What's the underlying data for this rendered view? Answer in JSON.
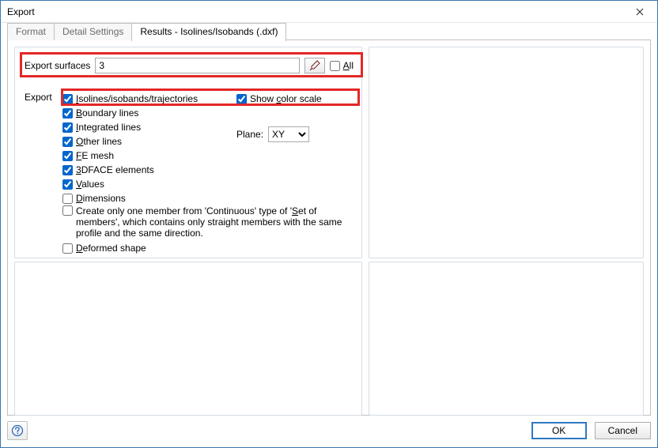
{
  "window": {
    "title": "Export"
  },
  "tabs": {
    "format": "Format",
    "detail": "Detail Settings",
    "results": "Results - Isolines/Isobands (.dxf)"
  },
  "surfaces": {
    "label": "Export surfaces",
    "value": "3",
    "all_label_u": "A",
    "all_label_rest": "ll"
  },
  "export": {
    "label": "Export",
    "items": {
      "isolines_u": "I",
      "isolines_rest": "solines/isobands/trajectories",
      "boundary_u": "B",
      "boundary_rest": "oundary lines",
      "integrated_u": "I",
      "integrated_rest": "ntegrated lines",
      "other_u": "O",
      "other_rest": "ther lines",
      "femesh_u": "F",
      "femesh_rest": "E mesh",
      "threedface_u": "3",
      "threedface_rest": "DFACE elements",
      "values_u": "V",
      "values_rest": "alues",
      "dimensions_u": "D",
      "dimensions_rest": "imensions",
      "onemember_pre": "Create only one member from 'Continuous' type of '",
      "onemember_u": "S",
      "onemember_post": "et of members', which contains only straight members with the same profile and the same direction.",
      "deformed_u": "D",
      "deformed_rest": "eformed shape"
    },
    "colorscale_pre": "Show ",
    "colorscale_u": "c",
    "colorscale_post": "olor scale",
    "plane_label_u": "P",
    "plane_label_rest": "lane:",
    "plane_value": "XY"
  },
  "footer": {
    "ok": "OK",
    "cancel": "Cancel"
  }
}
